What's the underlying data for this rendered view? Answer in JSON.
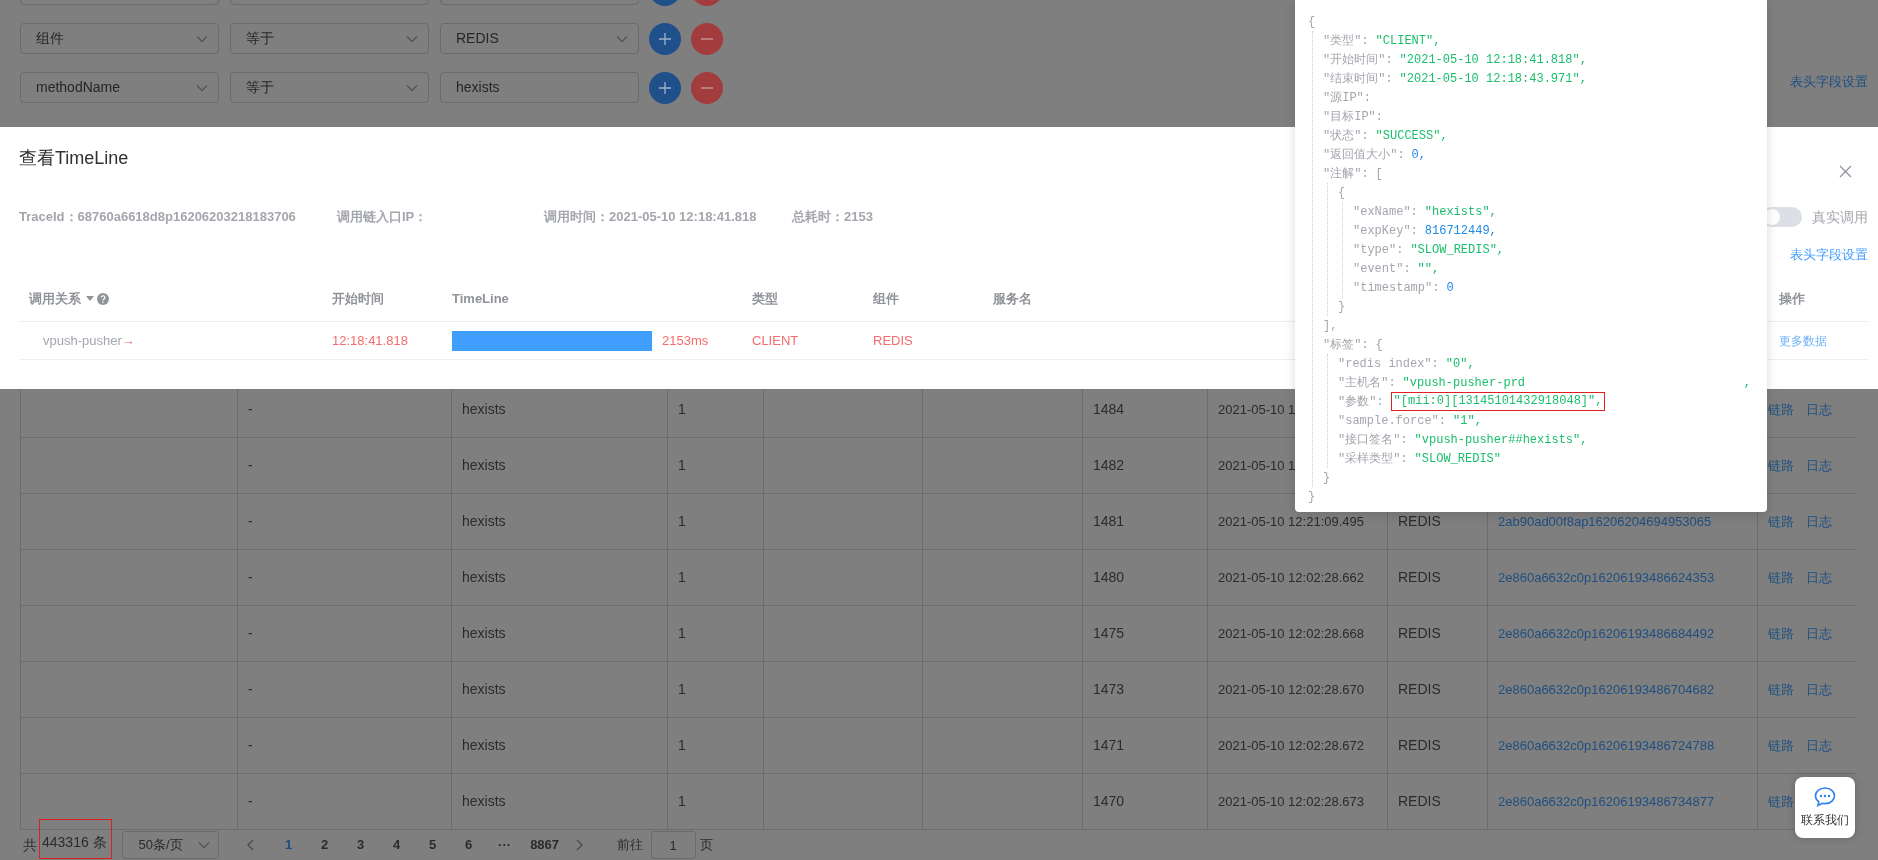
{
  "filters": [
    {
      "field": "组件",
      "operator": "等于",
      "value": "REDIS",
      "kind": "select"
    },
    {
      "field": "methodName",
      "operator": "等于",
      "value": "hexists",
      "kind": "input"
    }
  ],
  "page_header_link": "表头字段设置",
  "modal": {
    "title": "查看TimeLine",
    "info": [
      "TraceId：68760a6618d8p16206203218183706",
      "调用链入口IP：",
      "调用时间：2021-05-10 12:18:41.818",
      "总耗时：2153"
    ],
    "real_call_toggle": {
      "label": "真实调用",
      "on": false
    },
    "header_link": "表头字段设置",
    "columns": [
      "调用关系",
      "开始时间",
      "TimeLine",
      "类型",
      "组件",
      "服务名",
      "操作"
    ],
    "rows": [
      {
        "caller": "vpush-pusher",
        "arrow": "→",
        "start": "12:18:41.818",
        "duration": "2153ms",
        "type": "CLIENT",
        "component": "REDIS",
        "action": "更多数据"
      }
    ]
  },
  "json_popup": {
    "open": "{",
    "close": "}",
    "children": [
      {
        "kind": "string",
        "key": "\"类型\":",
        "value": "\"CLIENT\","
      },
      {
        "kind": "string",
        "key": "\"开始时间\":",
        "value": "\"2021-05-10 12:18:41.818\","
      },
      {
        "kind": "string",
        "key": "\"结束时间\":",
        "value": "\"2021-05-10 12:18:43.971\","
      },
      {
        "kind": "empty",
        "key": "\"源IP\":"
      },
      {
        "kind": "empty",
        "key": "\"目标IP\":"
      },
      {
        "kind": "string",
        "key": "\"状态\":",
        "value": "\"SUCCESS\","
      },
      {
        "kind": "number",
        "key": "\"返回值大小\":",
        "value": "0,"
      },
      {
        "kind": "group",
        "key": "\"注解\":",
        "value": "[",
        "close": "],",
        "children": [
          {
            "kind": "group",
            "value": "{",
            "close": "}",
            "children": [
              {
                "kind": "string",
                "key": "\"exName\":",
                "value": "\"hexists\","
              },
              {
                "kind": "number",
                "key": "\"expKey\":",
                "value": "816712449,"
              },
              {
                "kind": "string",
                "key": "\"type\":",
                "value": "\"SLOW_REDIS\","
              },
              {
                "kind": "string",
                "key": "\"event\":",
                "value": "\"\","
              },
              {
                "kind": "number",
                "key": "\"timestamp\":",
                "value": "0"
              }
            ]
          }
        ]
      },
      {
        "kind": "group",
        "key": "\"标签\":",
        "value": "{",
        "close": "}",
        "children": [
          {
            "kind": "string",
            "key": "\"redis index\":",
            "value": "\"0\","
          },
          {
            "kind": "string",
            "key": "\"主机名\":",
            "value": "\"vpush-pusher-prd",
            "tail": ","
          },
          {
            "kind": "string",
            "key": "\"参数\":",
            "value": "\"[mii:0][13145101432918048]\",",
            "highlighted": true
          },
          {
            "kind": "string",
            "key": "\"sample.force\":",
            "value": "\"1\","
          },
          {
            "kind": "string",
            "key": "\"接口签名\":",
            "value": "\"vpush-pusher##hexists\","
          },
          {
            "kind": "string",
            "key": "\"采样类型\":",
            "value": "\"SLOW_REDIS\""
          }
        ]
      }
    ]
  },
  "table": {
    "rows": [
      {
        "column_2": "-",
        "column_3": "hexists",
        "column_4": "1",
        "column_7": "1484",
        "column_8": "2021-05-10 1",
        "actions": [
          "链路",
          "日志"
        ]
      },
      {
        "column_2": "-",
        "column_3": "hexists",
        "column_4": "1",
        "column_7": "1482",
        "column_8": "2021-05-10 1",
        "actions": [
          "链路",
          "日志"
        ]
      },
      {
        "column_2": "-",
        "column_3": "hexists",
        "column_4": "1",
        "column_7": "1481",
        "column_8": "2021-05-10 12:21:09.495",
        "column_9": "REDIS",
        "column_10": "2ab90ad00f8ap16206204694953065",
        "actions": [
          "链路",
          "日志"
        ]
      },
      {
        "column_2": "-",
        "column_3": "hexists",
        "column_4": "1",
        "column_7": "1480",
        "column_8": "2021-05-10 12:02:28.662",
        "column_9": "REDIS",
        "column_10": "2e860a6632c0p16206193486624353",
        "actions": [
          "链路",
          "日志"
        ]
      },
      {
        "column_2": "-",
        "column_3": "hexists",
        "column_4": "1",
        "column_7": "1475",
        "column_8": "2021-05-10 12:02:28.668",
        "column_9": "REDIS",
        "column_10": "2e860a6632c0p16206193486684492",
        "actions": [
          "链路",
          "日志"
        ]
      },
      {
        "column_2": "-",
        "column_3": "hexists",
        "column_4": "1",
        "column_7": "1473",
        "column_8": "2021-05-10 12:02:28.670",
        "column_9": "REDIS",
        "column_10": "2e860a6632c0p16206193486704682",
        "actions": [
          "链路",
          "日志"
        ]
      },
      {
        "column_2": "-",
        "column_3": "hexists",
        "column_4": "1",
        "column_7": "1471",
        "column_8": "2021-05-10 12:02:28.672",
        "column_9": "REDIS",
        "column_10": "2e860a6632c0p16206193486724788",
        "actions": [
          "链路",
          "日志"
        ]
      },
      {
        "column_2": "-",
        "column_3": "hexists",
        "column_4": "1",
        "column_7": "1470",
        "column_8": "2021-05-10 12:02:28.673",
        "column_9": "REDIS",
        "column_10": "2e860a6632c0p16206193486734877",
        "actions": [
          "链路"
        ]
      }
    ]
  },
  "pagination": {
    "prefix": "共",
    "total": "443316 条",
    "total_highlighted": true,
    "page_size": "50条/页",
    "pages": [
      {
        "label": "1",
        "selected": true
      },
      {
        "label": "2",
        "selected": false
      },
      {
        "label": "3",
        "selected": false
      },
      {
        "label": "4",
        "selected": false
      },
      {
        "label": "5",
        "selected": false
      },
      {
        "label": "6",
        "selected": false
      },
      {
        "label": "···",
        "selected": false
      },
      {
        "label": "8867",
        "selected": false
      }
    ],
    "goto_label": "前往",
    "goto_value": "1",
    "goto_suffix": "页"
  },
  "contact_button": "联系我们"
}
